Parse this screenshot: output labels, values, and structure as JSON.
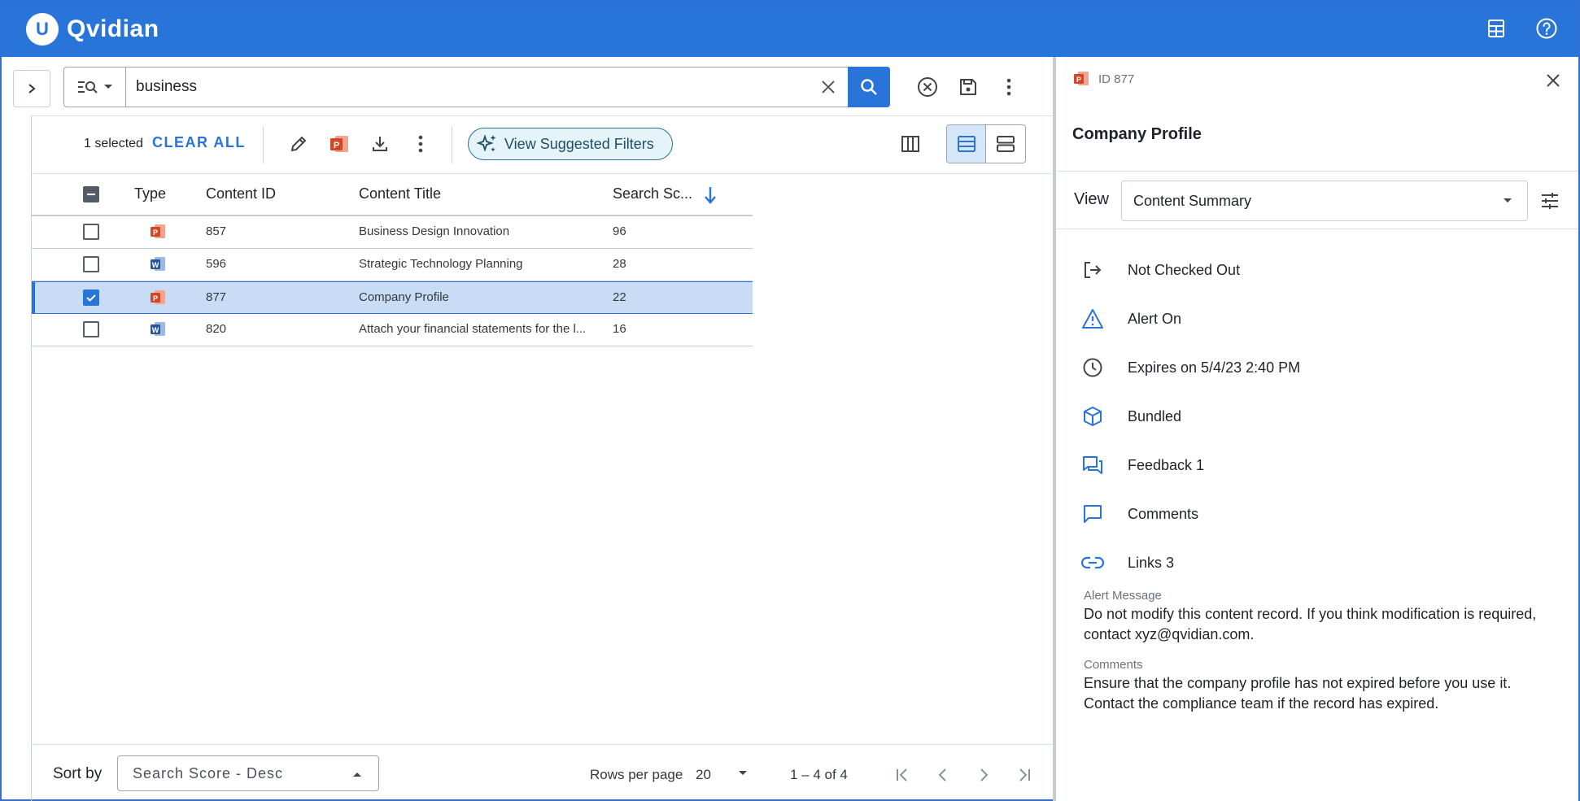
{
  "app": {
    "brand": "Qvidian",
    "logo_letter": "U"
  },
  "header": {
    "icons": [
      "calculator-icon",
      "help-icon"
    ]
  },
  "search": {
    "value": "business",
    "mode_icon": "search-filter-icon"
  },
  "toolbar": {
    "selected_text": "1 selected",
    "clear_all": "CLEAR ALL",
    "suggested_filters": "View Suggested Filters"
  },
  "table": {
    "columns": [
      "Type",
      "Content ID",
      "Content Title",
      "Search Sc..."
    ],
    "rows": [
      {
        "type": "powerpoint",
        "id": "857",
        "title": "Business Design Innovation",
        "score": "96",
        "selected": false
      },
      {
        "type": "word",
        "id": "596",
        "title": "Strategic Technology Planning",
        "score": "28",
        "selected": false
      },
      {
        "type": "powerpoint",
        "id": "877",
        "title": "Company Profile",
        "score": "22",
        "selected": true
      },
      {
        "type": "word",
        "id": "820",
        "title": "Attach your financial statements for the l...",
        "score": "16",
        "selected": false
      }
    ]
  },
  "footer": {
    "sort_label": "Sort by",
    "sort_value": "Search Score - Desc",
    "rows_per_page_label": "Rows per page",
    "rows_per_page": "20",
    "range": "1 – 4 of 4"
  },
  "detail": {
    "id_label": "ID 877",
    "title": "Company Profile",
    "view_label": "View",
    "view_value": "Content Summary",
    "status": [
      {
        "icon": "check-out-icon",
        "text": "Not Checked Out"
      },
      {
        "icon": "alert-icon",
        "text": "Alert On"
      },
      {
        "icon": "clock-icon",
        "text": "Expires on 5/4/23 2:40 PM"
      },
      {
        "icon": "cube-icon",
        "text": "Bundled"
      },
      {
        "icon": "feedback-icon",
        "text": "Feedback 1"
      },
      {
        "icon": "comment-icon",
        "text": "Comments"
      },
      {
        "icon": "link-icon",
        "text": "Links 3"
      }
    ],
    "alert_message_label": "Alert Message",
    "alert_message": "Do not modify this content record. If you think modification is required, contact xyz@qvidian.com.",
    "comments_label": "Comments",
    "comments": "Ensure that the company profile has not expired before you use it. Contact the compliance team if the record has expired."
  },
  "colors": {
    "brand": "#2874d9",
    "selected_row": "#c9dcf6",
    "powerpoint": "#d24726",
    "word": "#2b579a"
  }
}
